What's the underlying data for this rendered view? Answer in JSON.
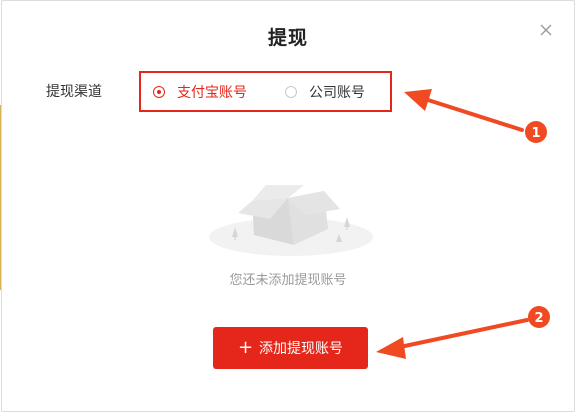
{
  "dialog": {
    "title": "提现",
    "close_icon": "close-icon"
  },
  "withdraw_channel": {
    "label": "提现渠道",
    "options": [
      {
        "label": "支付宝账号",
        "selected": true
      },
      {
        "label": "公司账号",
        "selected": false
      }
    ]
  },
  "empty_state": {
    "icon": "empty-box-icon",
    "message": "您还未添加提现账号"
  },
  "add_button": {
    "icon": "plus-icon",
    "label": "添加提现账号"
  },
  "annotations": [
    {
      "number": "1"
    },
    {
      "number": "2"
    }
  ],
  "colors": {
    "accent": "#e4261b",
    "annotation_arrow": "#f04a23"
  }
}
